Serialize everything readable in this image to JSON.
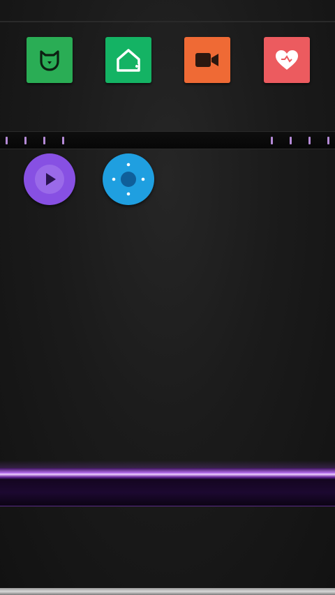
{
  "apps_row": [
    {
      "icon": "mi-home-cat-icon",
      "color": "#2aad55"
    },
    {
      "icon": "smart-home-icon",
      "color": "#14b364"
    },
    {
      "icon": "video-camera-icon",
      "color": "#ef6a35"
    },
    {
      "icon": "heart-icon",
      "color": "#ec5b5f"
    }
  ],
  "round_apps": [
    {
      "icon": "play-icon",
      "color": "#8750e3"
    },
    {
      "icon": "remote-control-icon",
      "color": "#1f9fe0"
    }
  ],
  "theme": {
    "accent": "#b76ff0",
    "tick_color": "#b48ad6",
    "background": "#1b1b1b"
  }
}
